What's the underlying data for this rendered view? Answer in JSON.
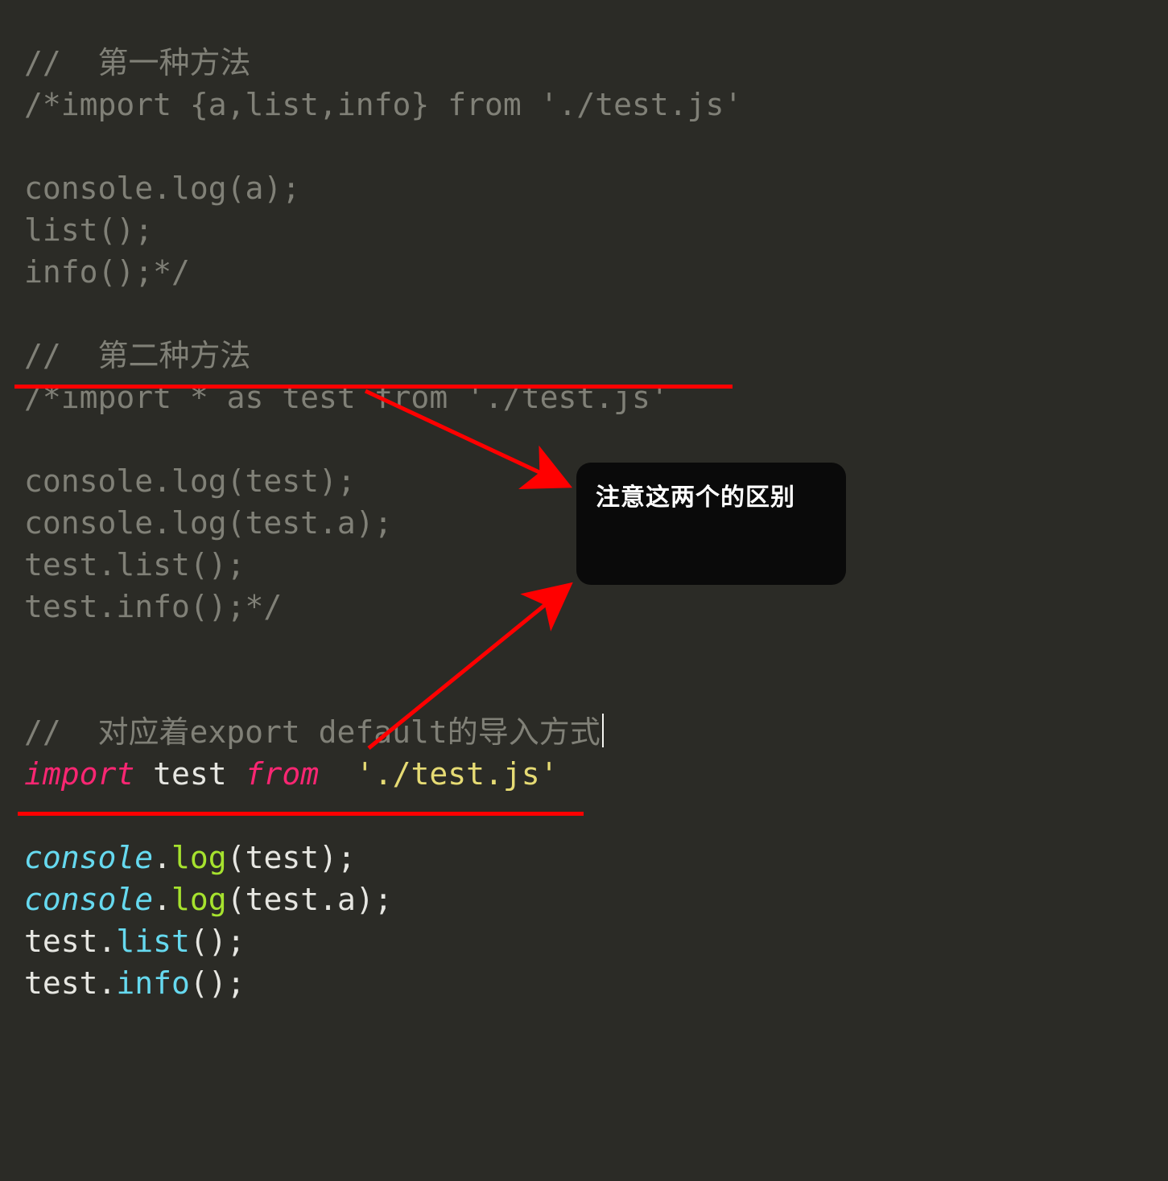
{
  "code": {
    "c1": "//  第一种方法",
    "c2": "/*import {a,list,info} from './test.js'",
    "c3": "console.log(a);",
    "c4": "list();",
    "c5": "info();*/",
    "c6": "//  第二种方法",
    "c7": "/*import * as test from './test.js'",
    "c8": "console.log(test);",
    "c9": "console.log(test.a);",
    "c10": "test.list();",
    "c11": "test.info();*/",
    "c12_prefix": "//  对应着export default的导入方式",
    "imp_kw": "import",
    "imp_id": "test",
    "from_kw": "from",
    "imp_str": "'./test.js'",
    "console": "console",
    "log": "log",
    "test": "test",
    "a": "a",
    "list": "list",
    "info": "info",
    "open": "(",
    "close": ")",
    "semi": ";",
    "dot": "."
  },
  "callout": {
    "text": "注意这两个的区别"
  },
  "colors": {
    "background": "#2b2b26",
    "comment": "#808077",
    "keyword": "#f92672",
    "identifier": "#e6e6e1",
    "string": "#e6db74",
    "object": "#66d9ef",
    "function": "#a6e22e",
    "annotation_red": "#ff0000",
    "callout_bg": "#0a0a0a",
    "callout_text": "#ffffff"
  }
}
